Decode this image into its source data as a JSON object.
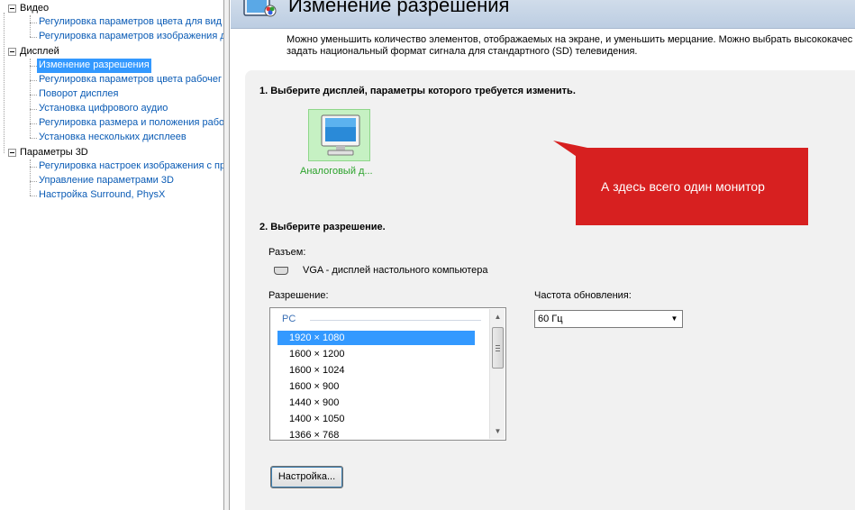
{
  "tree": {
    "groups": [
      {
        "label": "Видео",
        "children": [
          "Регулировка параметров цвета для вид",
          "Регулировка параметров изображения д"
        ]
      },
      {
        "label": "Дисплей",
        "children": [
          "Изменение разрешения",
          "Регулировка параметров цвета рабочег",
          "Поворот дисплея",
          "Установка цифрового аудио",
          "Регулировка размера и положения рабо",
          "Установка нескольких дисплеев"
        ]
      },
      {
        "label": "Параметры 3D",
        "children": [
          "Регулировка настроек изображения с пр",
          "Управление параметрами 3D",
          "Настройка Surround, PhysX"
        ]
      }
    ],
    "selected": "Изменение разрешения"
  },
  "header": {
    "title": "Изменение разрешения",
    "icon": "display-settings-icon"
  },
  "description": {
    "line1": "Можно уменьшить количество элементов, отображаемых на экране, и уменьшить мерцание. Можно выбрать высококачес",
    "line2": "задать национальный формат сигнала для стандартного (SD) телевидения."
  },
  "step1": {
    "title": "1. Выберите дисплей, параметры которого требуется изменить.",
    "display_label": "Аналоговый д..."
  },
  "callout": {
    "text": "А здесь всего один монитор",
    "color": "#d72020"
  },
  "step2": {
    "title": "2. Выберите разрешение.",
    "connector_label": "Разъем:",
    "connector_value": "VGA - дисплей настольного компьютера",
    "resolution_label": "Разрешение:",
    "refresh_label": "Частота обновления:",
    "refresh_value": "60 Гц",
    "resolution_group": "PC",
    "resolutions": [
      "1920 × 1080",
      "1600 × 1200",
      "1600 × 1024",
      "1600 × 900",
      "1440 × 900",
      "1400 × 1050",
      "1366 × 768"
    ],
    "selected_resolution": "1920 × 1080",
    "setup_button": "Настройка..."
  },
  "colors": {
    "selection": "#3399ff",
    "link": "#0a5bb5",
    "display_label": "#2aa22a"
  }
}
